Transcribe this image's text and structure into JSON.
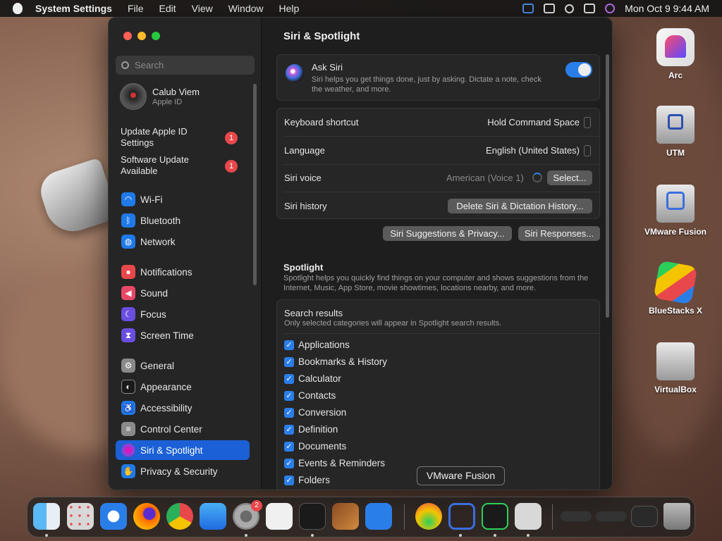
{
  "menubar": {
    "app": "System Settings",
    "items": [
      "File",
      "Edit",
      "View",
      "Window",
      "Help"
    ],
    "clock": "Mon Oct 9  9:44 AM"
  },
  "sidebar": {
    "search_placeholder": "Search",
    "profile": {
      "name": "Calub Viem",
      "sub": "Apple ID"
    },
    "updates": [
      {
        "label": "Update Apple ID Settings",
        "count": "1"
      },
      {
        "label": "Software Update Available",
        "count": "1"
      }
    ],
    "items": [
      {
        "label": "Wi-Fi",
        "color": "#1f7ae8"
      },
      {
        "label": "Bluetooth",
        "color": "#1f7ae8"
      },
      {
        "label": "Network",
        "color": "#1f7ae8"
      },
      {
        "label": "Notifications",
        "color": "#e8484b"
      },
      {
        "label": "Sound",
        "color": "#e84868"
      },
      {
        "label": "Focus",
        "color": "#6a4ee0"
      },
      {
        "label": "Screen Time",
        "color": "#6a4ee0"
      },
      {
        "label": "General",
        "color": "#8a8a8a"
      },
      {
        "label": "Appearance",
        "color": "#1a1a1a"
      },
      {
        "label": "Accessibility",
        "color": "#1f7ae8"
      },
      {
        "label": "Control Center",
        "color": "#8a8a8a"
      },
      {
        "label": "Siri & Spotlight",
        "color": "#7a4ee0"
      },
      {
        "label": "Privacy & Security",
        "color": "#1f7ae8"
      }
    ],
    "selected": "Siri & Spotlight"
  },
  "main": {
    "title": "Siri & Spotlight",
    "ask_siri": {
      "title": "Ask Siri",
      "desc": "Siri helps you get things done, just by asking. Dictate a note, check the weather, and more.",
      "enabled": true
    },
    "rows": {
      "shortcut": {
        "label": "Keyboard shortcut",
        "value": "Hold Command Space"
      },
      "language": {
        "label": "Language",
        "value": "English (United States)"
      },
      "voice": {
        "label": "Siri voice",
        "value": "American (Voice 1)",
        "button": "Select..."
      },
      "history": {
        "label": "Siri history",
        "button": "Delete Siri & Dictation History..."
      }
    },
    "buttons": {
      "suggestions": "Siri Suggestions & Privacy...",
      "responses": "Siri Responses..."
    },
    "spotlight": {
      "title": "Spotlight",
      "desc": "Spotlight helps you quickly find things on your computer and shows suggestions from the Internet, Music, App Store, movie showtimes, locations nearby, and more."
    },
    "search_results": {
      "title": "Search results",
      "desc": "Only selected categories will appear in Spotlight search results.",
      "items": [
        "Applications",
        "Bookmarks & History",
        "Calculator",
        "Contacts",
        "Conversion",
        "Definition",
        "Documents",
        "Events & Reminders",
        "Folders"
      ]
    }
  },
  "desktop": [
    {
      "label": "Arc"
    },
    {
      "label": "UTM"
    },
    {
      "label": "VMware Fusion"
    },
    {
      "label": "BlueStacks X"
    },
    {
      "label": "VirtualBox"
    }
  ],
  "dock": {
    "tooltip": "VMware Fusion",
    "settings_badge": "2"
  }
}
